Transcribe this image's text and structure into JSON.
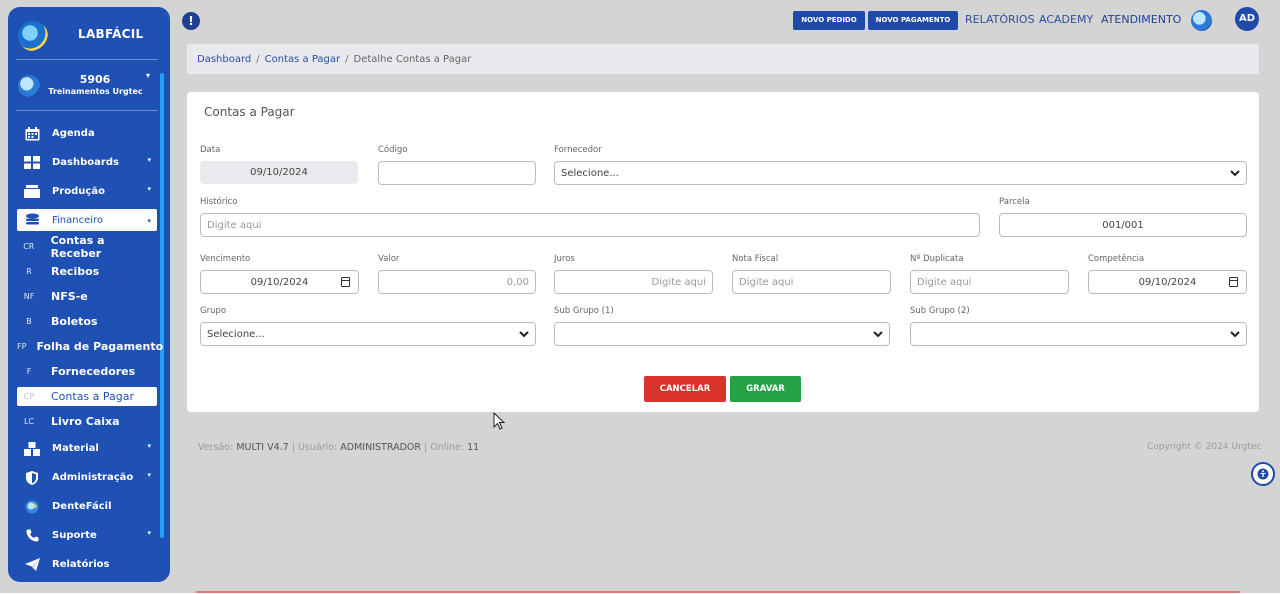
{
  "sidebar": {
    "brand": "LABFÁCIL",
    "user_code": "5906",
    "user_name": "Treinamentos Urgtec",
    "menu": [
      {
        "label": "Agenda",
        "icon": "calendar-icon"
      },
      {
        "label": "Dashboards",
        "icon": "grid-icon",
        "caret": "▾"
      },
      {
        "label": "Produção",
        "icon": "box-icon",
        "caret": "▾"
      },
      {
        "label": "Financeiro",
        "icon": "coins-icon",
        "caret": "▾"
      }
    ],
    "submenu": [
      {
        "abbr": "CR",
        "label": "Contas a Receber"
      },
      {
        "abbr": "R",
        "label": "Recibos"
      },
      {
        "abbr": "NF",
        "label": "NFS-e"
      },
      {
        "abbr": "B",
        "label": "Boletos"
      },
      {
        "abbr": "FP",
        "label": "Folha de Pagamento"
      },
      {
        "abbr": "F",
        "label": "Fornecedores"
      },
      {
        "abbr": "CP",
        "label": "Contas a Pagar"
      },
      {
        "abbr": "LC",
        "label": "Livro Caixa"
      }
    ],
    "menu_bottom": [
      {
        "label": "Material",
        "icon": "boxes-icon",
        "caret": "▾"
      },
      {
        "label": "Administração",
        "icon": "shield-icon",
        "caret": "▾"
      },
      {
        "label": "DenteFácil",
        "icon": "globe-icon"
      },
      {
        "label": "Suporte",
        "icon": "phone-icon",
        "caret": "▾"
      },
      {
        "label": "Relatórios",
        "icon": "paper-plane-icon"
      }
    ]
  },
  "topbar": {
    "alert": "!",
    "btn_novo_pedido": "NOVO PEDIDO",
    "btn_novo_pagamento": "NOVO PAGAMENTO",
    "link_relatorios": "RELATÓRIOS",
    "link_academy": "ACADEMY",
    "link_atendimento": "ATENDIMENTO",
    "avatar": "AD"
  },
  "breadcrumb": {
    "dashboard": "Dashboard",
    "contas": "Contas a Pagar",
    "current": "Detalhe Contas a Pagar",
    "sep": "/"
  },
  "form": {
    "title": "Contas a Pagar",
    "data_label": "Data",
    "data_value": "09/10/2024",
    "codigo_label": "Código",
    "codigo_value": "",
    "fornecedor_label": "Fornecedor",
    "fornecedor_value": "Selecione...",
    "historico_label": "Histórico",
    "historico_placeholder": "Digite aqui",
    "parcela_label": "Parcela",
    "parcela_value": "001/001",
    "vencimento_label": "Vencimento",
    "vencimento_value": "09/10/2024",
    "valor_label": "Valor",
    "valor_placeholder": "0,00",
    "juros_label": "Juros",
    "juros_placeholder": "Digite aqui",
    "nota_label": "Nota Fiscal",
    "nota_placeholder": "Digite aqui",
    "duplicata_label": "Nº Duplicata",
    "duplicata_placeholder": "Digite aqui",
    "competencia_label": "Competência",
    "competencia_value": "09/10/2024",
    "grupo_label": "Grupo",
    "grupo_value": "Selecione...",
    "subgrupo1_label": "Sub Grupo (1)",
    "subgrupo1_value": "",
    "subgrupo2_label": "Sub Grupo (2)",
    "subgrupo2_value": "",
    "cancel_label": "CANCELAR",
    "save_label": "GRAVAR"
  },
  "footer": {
    "versao_label": "Versão:",
    "versao": "MULTI V4.7",
    "usuario_label": "| Usuário:",
    "usuario": "ADMINISTRADOR",
    "online_label": "| Online:",
    "online": "11",
    "copyright": "Copyright © 2024 Urgtec"
  },
  "colors": {
    "sidebar": "#1f50b4",
    "cancel": "#d9332b",
    "save": "#25a244"
  }
}
